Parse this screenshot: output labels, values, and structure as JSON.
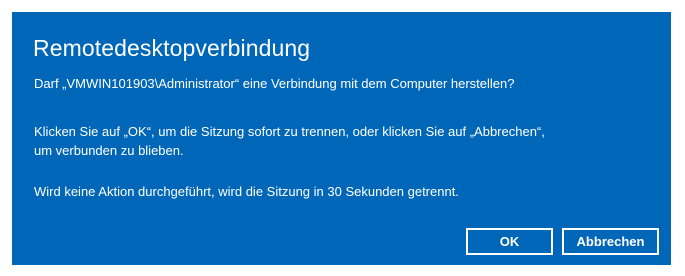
{
  "dialog": {
    "title": "Remotedesktopverbindung",
    "question": "Darf „VMWIN101903\\Administrator“ eine Verbindung mit dem Computer herstellen?",
    "instruction_line1": "Klicken Sie auf „OK“, um die Sitzung sofort zu trennen, oder klicken Sie auf „Abbrechen“,",
    "instruction_line2": "um verbunden zu blieben.",
    "timeout_notice": "Wird keine Aktion durchgeführt, wird die Sitzung in 30 Sekunden getrennt.",
    "ok_label": "OK",
    "cancel_label": "Abbrechen"
  },
  "colors": {
    "dialog_background": "#0067b8",
    "text": "#ffffff"
  }
}
